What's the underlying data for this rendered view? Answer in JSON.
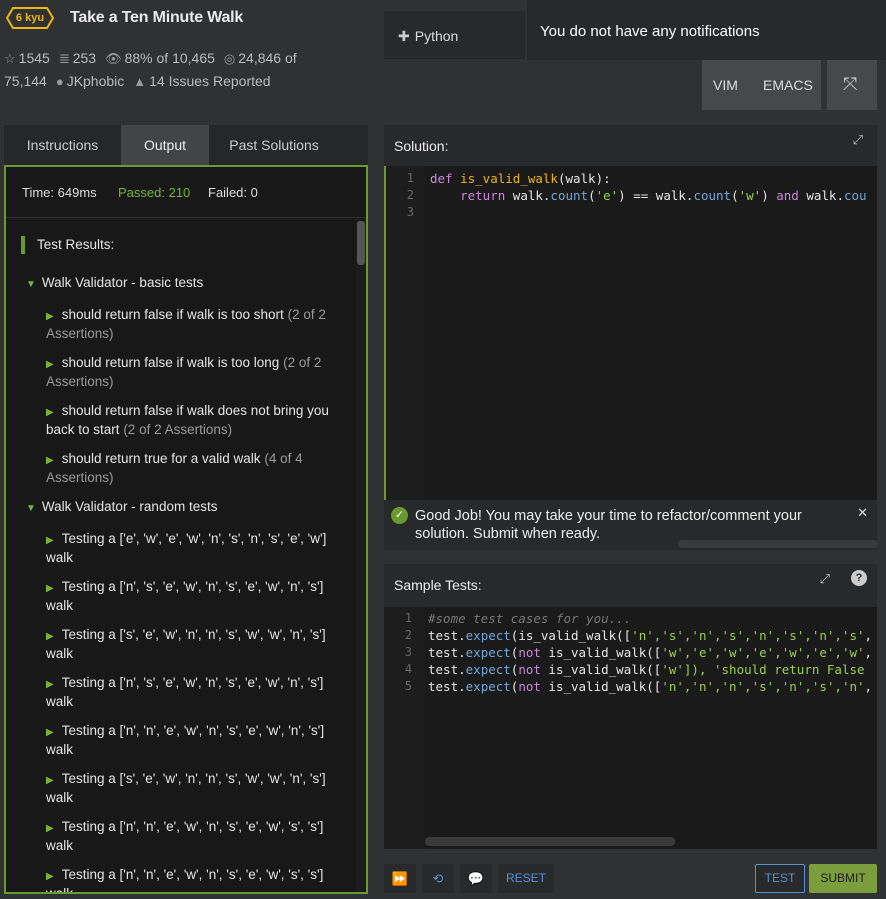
{
  "kata": {
    "rank": "6 kyu",
    "title": "Take a Ten Minute Walk",
    "stats": {
      "stars": "1545",
      "collections": "253",
      "satisfaction_pct": "88%",
      "satisfaction_of": "of 10,465",
      "completed": "24,846",
      "completed_of": "of",
      "completed_total": "75,144",
      "author": "JKphobic",
      "issues": "14 Issues Reported"
    }
  },
  "language": "Python",
  "notifications": "You do not have any notifications",
  "editor_modes": {
    "vim": "VIM",
    "emacs": "EMACS"
  },
  "tabs": [
    {
      "label": "Instructions",
      "active": false
    },
    {
      "label": "Output",
      "active": true
    },
    {
      "label": "Past Solutions",
      "active": false
    }
  ],
  "output": {
    "time": "Time: 649ms",
    "passed": "Passed: 210",
    "failed": "Failed: 0",
    "results_title": "Test Results:",
    "groups": [
      {
        "title": "Walk Validator - basic tests",
        "tests": [
          {
            "text": "should return false if walk is too short",
            "assert": "(2 of 2 Assertions)"
          },
          {
            "text": "should return false if walk is too long",
            "assert": "(2 of 2 Assertions)"
          },
          {
            "text": "should return false if walk does not bring you back to start",
            "assert": "(2 of 2 Assertions)"
          },
          {
            "text": "should return true for a valid walk",
            "assert": "(4 of 4 Assertions)"
          }
        ]
      },
      {
        "title": "Walk Validator - random tests",
        "tests": [
          {
            "text": "Testing a ['e', 'w', 'e', 'w', 'n', 's', 'n', 's', 'e', 'w'] walk"
          },
          {
            "text": "Testing a ['n', 's', 'e', 'w', 'n', 's', 'e', 'w', 'n', 's'] walk"
          },
          {
            "text": "Testing a ['s', 'e', 'w', 'n', 'n', 's', 'w', 'w', 'n', 's'] walk"
          },
          {
            "text": "Testing a ['n', 's', 'e', 'w', 'n', 's', 'e', 'w', 'n', 's'] walk"
          },
          {
            "text": "Testing a ['n', 'n', 'e', 'w', 'n', 's', 'e', 'w', 'n', 's'] walk"
          },
          {
            "text": "Testing a ['s', 'e', 'w', 'n', 'n', 's', 'w', 'w', 'n', 's'] walk"
          },
          {
            "text": "Testing a ['n', 'n', 'e', 'w', 'n', 's', 'e', 'w', 's', 's'] walk"
          },
          {
            "text": "Testing a ['n', 'n', 'e', 'w', 'n', 's', 'e', 'w', 's', 's'] walk"
          }
        ]
      }
    ]
  },
  "solution": {
    "title": "Solution:",
    "line_numbers": [
      "1",
      "2",
      "3"
    ],
    "code": {
      "l1_def": "def",
      "l1_name": "is_valid_walk",
      "l1_rest": "(walk):",
      "l2_indent": "    ",
      "l2_return": "return",
      "l2_a": " walk.",
      "l2_count1": "count",
      "l2_b": "(",
      "l2_e": "'e'",
      "l2_c": ") == walk.",
      "l2_count2": "count",
      "l2_d": "(",
      "l2_w": "'w'",
      "l2_f": ") ",
      "l2_and": "and",
      "l2_g": " walk.",
      "l2_count3": "cou"
    }
  },
  "feedback": "Good Job! You may take your time to refactor/comment your solution. Submit when ready.",
  "sample_tests": {
    "title": "Sample Tests:",
    "line_numbers": [
      "1",
      "2",
      "3",
      "4",
      "5"
    ],
    "comment": "#some test cases for you...",
    "lines": [
      {
        "prefix": "test.",
        "method": "expect",
        "open": "(",
        "not": "",
        "fn": "is_valid_walk([",
        "args": "'n','s','n','s','n','s','n','s'",
        "tail": ","
      },
      {
        "prefix": "test.",
        "method": "expect",
        "open": "(",
        "not": "not",
        "fn": " is_valid_walk([",
        "args": "'w','e','w','e','w','e','w'",
        "tail": ","
      },
      {
        "prefix": "test.",
        "method": "expect",
        "open": "(",
        "not": "not",
        "fn": " is_valid_walk([",
        "args": "'w'",
        "tail": "]), 'should return False"
      },
      {
        "prefix": "test.",
        "method": "expect",
        "open": "(",
        "not": "not",
        "fn": " is_valid_walk([",
        "args": "'n','n','n','s','n','s','n'",
        "tail": ","
      }
    ]
  },
  "buttons": {
    "reset": "RESET",
    "test": "TEST",
    "submit": "SUBMIT"
  }
}
